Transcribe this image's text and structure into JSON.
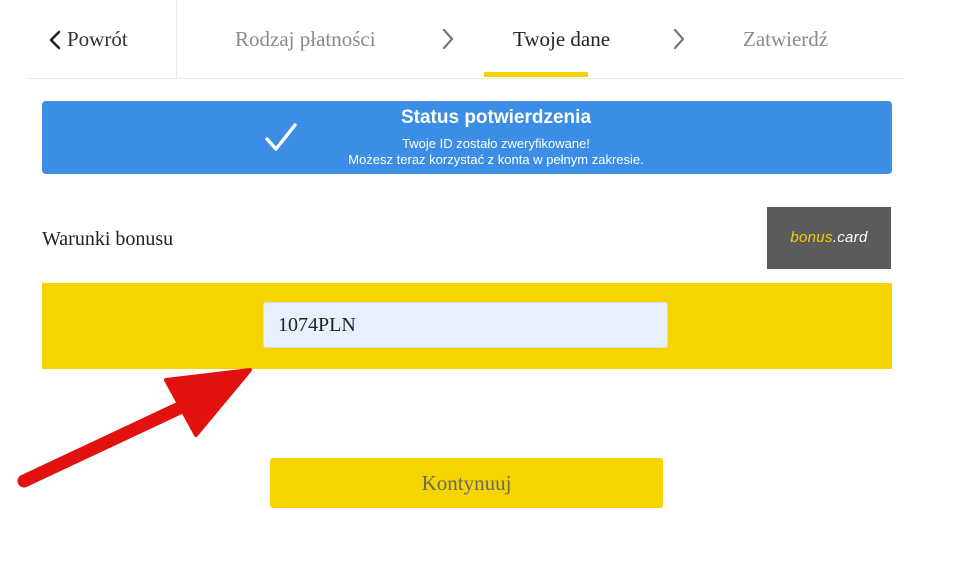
{
  "nav": {
    "back_label": "Powrót",
    "steps": [
      {
        "label": "Rodzaj płatności",
        "active": false
      },
      {
        "label": "Twoje dane",
        "active": true
      },
      {
        "label": "Zatwierdź",
        "active": false
      }
    ]
  },
  "banner": {
    "title": "Status potwierdzenia",
    "line1": "Twoje ID zostało zweryfikowane!",
    "line2": "Możesz teraz korzystać z konta w pełnym zakresie.",
    "color": "#3c8de5"
  },
  "bonus": {
    "label": "Warunki bonusu",
    "logo": {
      "part1": "bonus",
      "part2": ".card"
    },
    "code_value": "1074PLN"
  },
  "continue_label": "Kontynuuj",
  "colors": {
    "accent_yellow": "#f5d400",
    "annotation_red": "#e31010"
  },
  "icons": {
    "back": "chevron-left-icon",
    "separator": "chevron-right-icon",
    "banner": "check-icon",
    "annotation": "red-arrow-icon"
  }
}
